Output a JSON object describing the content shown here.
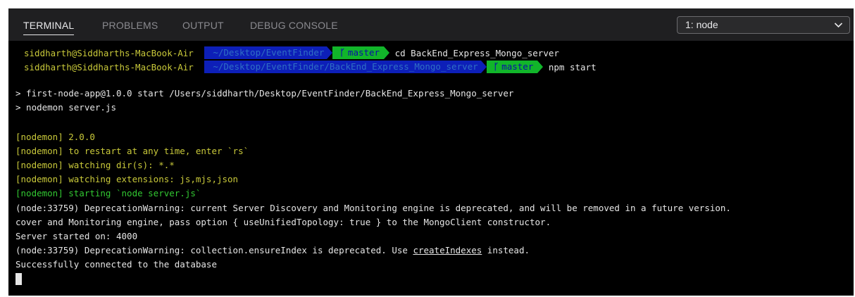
{
  "tabs": [
    {
      "label": "TERMINAL",
      "active": true
    },
    {
      "label": "PROBLEMS",
      "active": false
    },
    {
      "label": "OUTPUT",
      "active": false
    },
    {
      "label": "DEBUG CONSOLE",
      "active": false
    }
  ],
  "terminal_select": {
    "value": "1: node",
    "icon": "chevron-down-icon"
  },
  "prompt1": {
    "user": "siddharth@Siddharths-MacBook-Air",
    "path": "~/Desktop/EventFinder",
    "branch_icon": "branch-icon",
    "branch": "master",
    "command": "cd BackEnd_Express_Mongo_server"
  },
  "prompt2": {
    "user": "siddharth@Siddharths-MacBook-Air",
    "path": "~/Desktop/EventFinder/BackEnd_Express_Mongo_server",
    "branch_icon": "branch-icon",
    "branch": "master",
    "command": "npm start"
  },
  "output": {
    "l1": "> first-node-app@1.0.0 start /Users/siddharth/Desktop/EventFinder/BackEnd_Express_Mongo_server",
    "l2": "> nodemon server.js",
    "l3": "[nodemon] 2.0.0",
    "l4": "[nodemon] to restart at any time, enter `rs`",
    "l5": "[nodemon] watching dir(s): *.*",
    "l6": "[nodemon] watching extensions: js,mjs,json",
    "l7": "[nodemon] starting `node server.js`",
    "l8": "(node:33759) DeprecationWarning: current Server Discovery and Monitoring engine is deprecated, and will be removed in a future version.",
    "l9": "cover and Monitoring engine, pass option { useUnifiedTopology: true } to the MongoClient constructor.",
    "l10": "Server started on: 4000",
    "l11_pre": "(node:33759) DeprecationWarning: collection.ensureIndex is deprecated. Use ",
    "l11_link": "createIndexes",
    "l11_post": " instead.",
    "l12": "Successfully connected to the database"
  },
  "colors": {
    "background": "#000000",
    "nodemon_yellow": "#c9c93a",
    "nodemon_green": "#32c832",
    "path_segment": "#0d1fb8",
    "branch_segment": "#11b52a"
  }
}
